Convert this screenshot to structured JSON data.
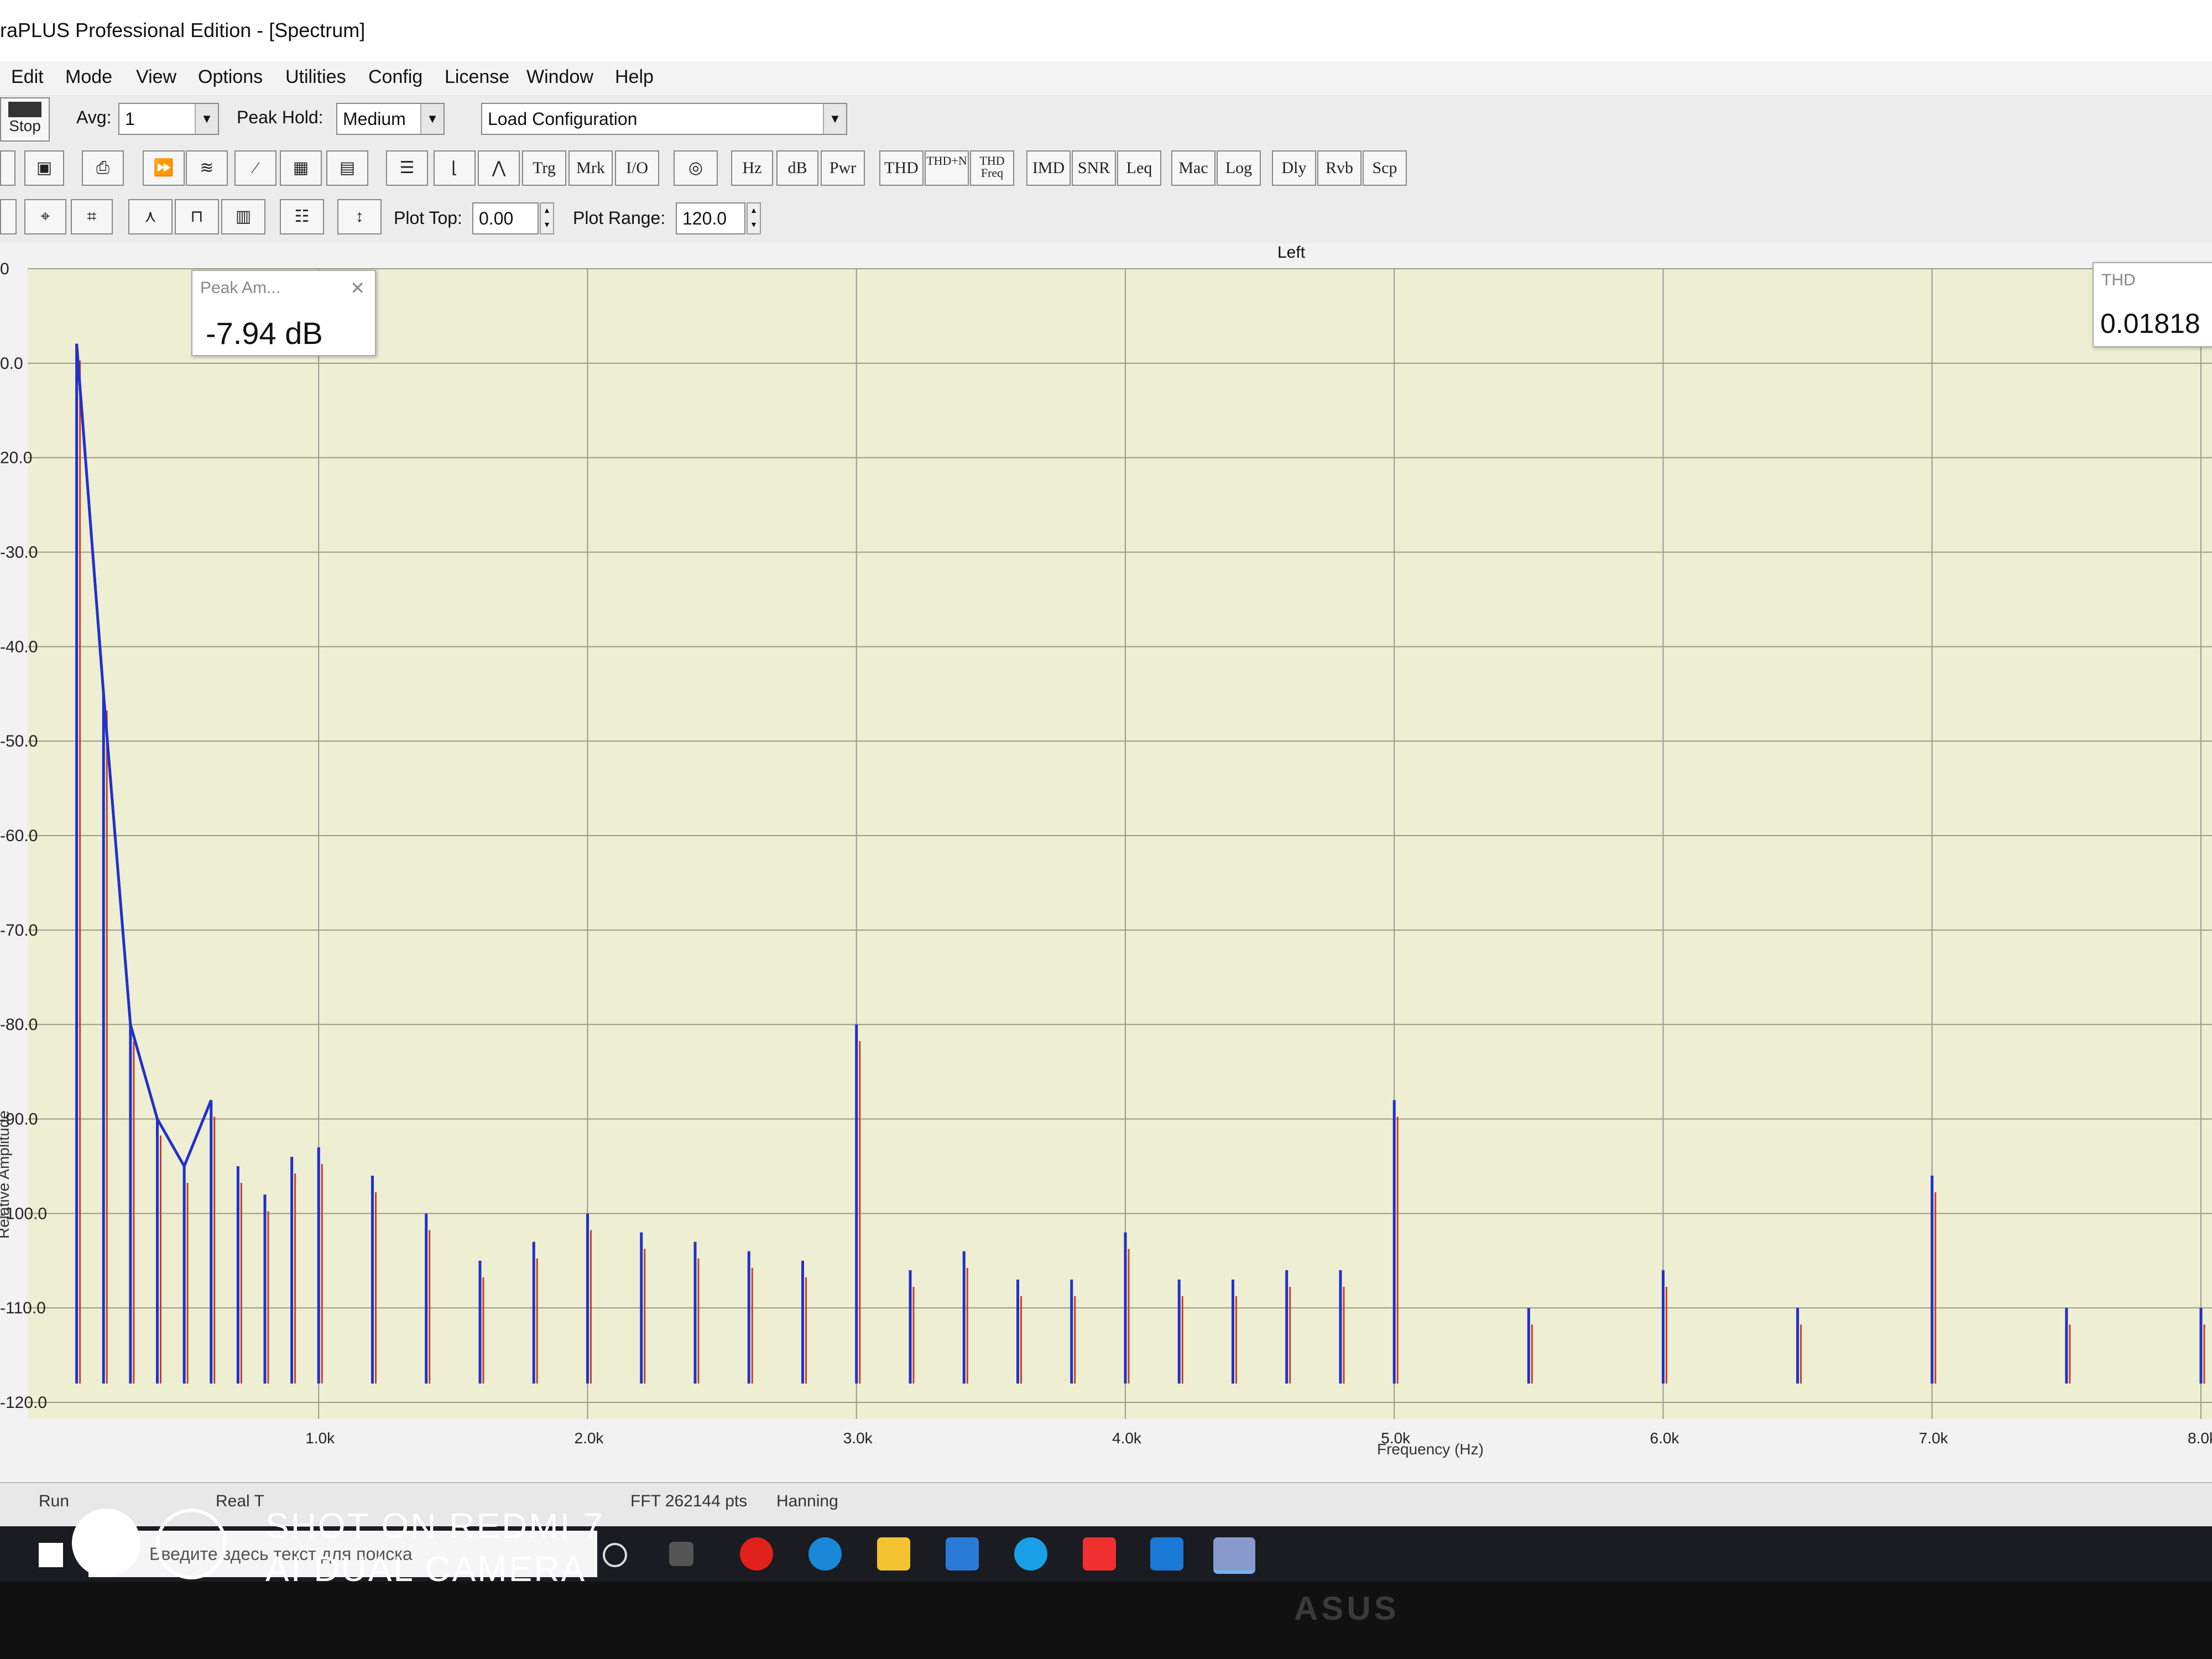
{
  "window": {
    "title": "raPLUS Professional Edition - [Spectrum]"
  },
  "menu": [
    "Edit",
    "Mode",
    "View",
    "Options",
    "Utilities",
    "Config",
    "License",
    "Window",
    "Help"
  ],
  "toolbar1": {
    "stop_label": "Stop",
    "avg_label": "Avg:",
    "avg_value": "1",
    "peak_hold_label": "Peak Hold:",
    "peak_hold_value": "Medium",
    "config_value": "Load Configuration"
  },
  "toolbar2": {
    "buttons": [
      "Trg",
      "Mrk",
      "I/O",
      "Hz",
      "dB",
      "Pwr",
      "THD",
      "THD+N",
      "THD Freq",
      "IMD",
      "SNR",
      "Leq",
      "Mac",
      "Log",
      "Dly",
      "Rvb",
      "Scp"
    ]
  },
  "toolbar3": {
    "plot_top_label": "Plot Top:",
    "plot_top_value": "0.00",
    "plot_range_label": "Plot Range:",
    "plot_range_value": "120.0"
  },
  "plot": {
    "channel_label": "Left",
    "y_axis_label": "Relative Amplitude",
    "x_axis_label": "Frequency (Hz)",
    "y_ticks": [
      "0",
      "0.0",
      "20.0",
      "-30.0",
      "-40.0",
      "-50.0",
      "-60.0",
      "-70.0",
      "-80.0",
      "-90.0",
      "-100.0",
      "-110.0",
      "-120.0"
    ],
    "x_ticks": [
      "1.0k",
      "2.0k",
      "3.0k",
      "4.0k",
      "5.0k",
      "6.0k",
      "7.0k",
      "8.0k"
    ]
  },
  "peak_window": {
    "title": "Peak Am...",
    "value": "-7.94 dB"
  },
  "thd_window": {
    "title": "THD",
    "value": "0.01818"
  },
  "status": {
    "left": "Run",
    "mode": "Real T",
    "fft": "FFT 262144 pts",
    "window": "Hanning"
  },
  "taskbar": {
    "search_placeholder": "Введите здесь текст для поиска"
  },
  "camera_watermark": {
    "line1": "SHOT ON REDMI 7",
    "line2": "AI DUAL CAMERA"
  },
  "monitor_brand": "ASUS",
  "chart_data": {
    "type": "line",
    "ylim": [
      -120,
      0
    ],
    "xlim": [
      0,
      8000
    ],
    "series": [
      {
        "values_note": "",
        "x": [
          100,
          200,
          300,
          400,
          500,
          600,
          700,
          800,
          900,
          1000,
          1200,
          1400,
          1600,
          1800,
          2000,
          2200,
          2400,
          2600,
          2800,
          3000,
          3200,
          3400,
          3600,
          3800,
          4000,
          4200,
          4400,
          4600,
          4800,
          5000,
          5500,
          6000,
          6500,
          7000,
          7500,
          8000
        ],
        "y": [
          -7.94,
          -45,
          -80,
          -90,
          -95,
          -88,
          -95,
          -98,
          -94,
          -93,
          -96,
          -100,
          -105,
          -103,
          -100,
          -102,
          -103,
          -104,
          -105,
          -80,
          -106,
          -104,
          -107,
          -107,
          -102,
          -107,
          -107,
          -106,
          -106,
          -88,
          -110,
          -106,
          -110,
          -96,
          -110,
          -110
        ]
      }
    ]
  }
}
